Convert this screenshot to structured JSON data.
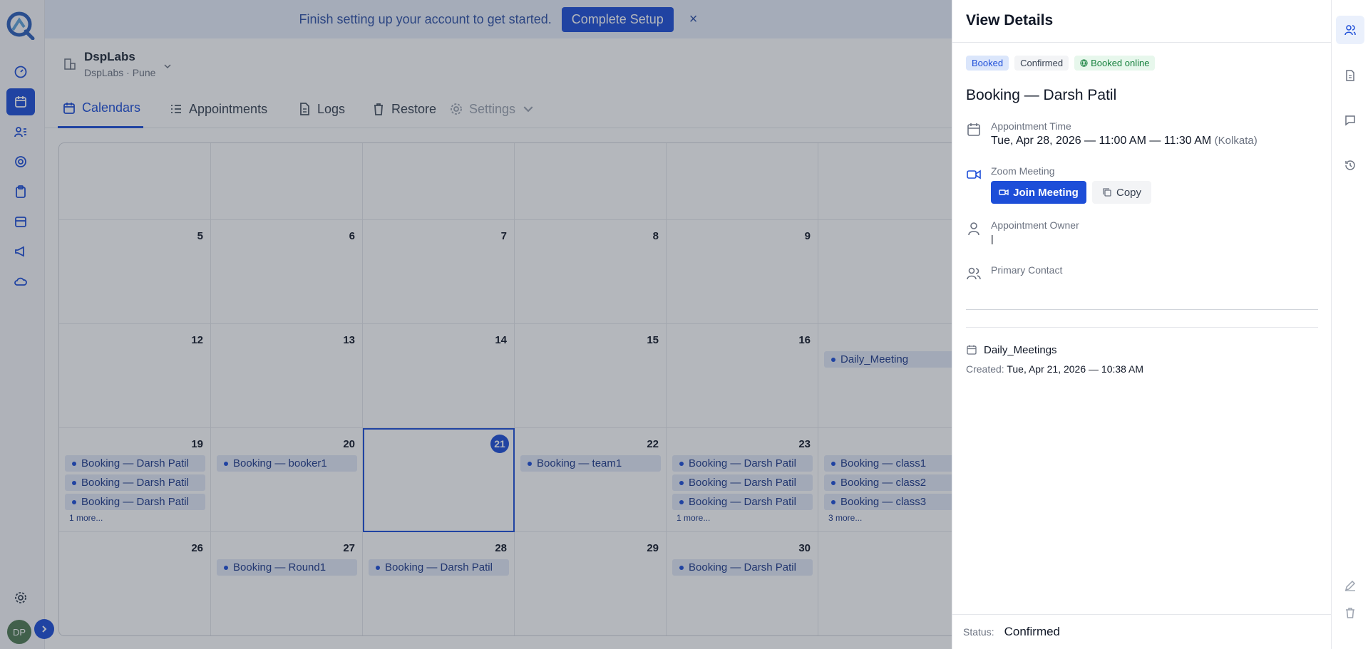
{
  "banner": {
    "text": "Finish setting up your account to get started.",
    "button": "Complete Setup",
    "close": "×"
  },
  "location": {
    "name": "DspLabs",
    "subtitle": "DspLabs · Pune"
  },
  "tabs": [
    {
      "label": "Calendars",
      "icon": "calendar-icon"
    },
    {
      "label": "Appointments",
      "icon": "list-icon"
    },
    {
      "label": "Logs",
      "icon": "document-icon"
    },
    {
      "label": "Restore",
      "icon": "trash-icon"
    },
    {
      "label": "Settings",
      "icon": "gear-icon"
    }
  ],
  "sidebar": {
    "avatar_initials": "DP"
  },
  "calendar": {
    "today": "21",
    "weeks": [
      {
        "days": [
          "",
          "",
          "",
          "",
          "",
          ""
        ]
      },
      {
        "days": [
          "5",
          "6",
          "7",
          "8",
          "9",
          ""
        ]
      },
      {
        "days": [
          "12",
          "13",
          "14",
          "15",
          "16",
          ""
        ]
      },
      {
        "days": [
          "19",
          "20",
          "21",
          "22",
          "23",
          ""
        ]
      },
      {
        "days": [
          "26",
          "27",
          "28",
          "29",
          "30",
          ""
        ]
      }
    ],
    "events": {
      "w2d5": [
        "Daily_Meeting"
      ],
      "w3d0": [
        "Booking — Darsh Patil",
        "Booking — Darsh Patil",
        "Booking — Darsh Patil"
      ],
      "w3d1": [
        "Booking — booker1"
      ],
      "w3d3": [
        "Booking — team1"
      ],
      "w3d4": [
        "Booking — Darsh Patil",
        "Booking — Darsh Patil",
        "Booking — Darsh Patil"
      ],
      "w3d5": [
        "Booking — class1",
        "Booking — class2",
        "Booking — class3"
      ],
      "w4d1": [
        "Booking — Round1"
      ],
      "w4d2": [
        "Booking — Darsh Patil"
      ],
      "w4d4": [
        "Booking — Darsh Patil"
      ]
    },
    "more": {
      "w3d0": "1 more...",
      "w3d4": "1 more...",
      "w3d5": "3 more..."
    }
  },
  "drawer": {
    "title": "View Details",
    "badges": {
      "booked": "Booked",
      "confirmed": "Confirmed",
      "online": "Booked online"
    },
    "booking_title": "Booking — Darsh Patil",
    "appointment_time_label": "Appointment Time",
    "appointment_time": "Tue, Apr 28, 2026 — 11:00 AM — 11:30 AM",
    "timezone": "(Kolkata)",
    "meeting_label": "Zoom Meeting",
    "join_label": "Join Meeting",
    "copy_label": "Copy",
    "owner_label": "Appointment Owner",
    "owner_value": "|",
    "contact_label": "Primary Contact",
    "calendar_name": "Daily_Meetings",
    "created_label": "Created:",
    "created_value": "Tue, Apr 21, 2026 — 10:38 AM",
    "status_label": "Status:",
    "status_value": "Confirmed"
  },
  "colors": {
    "accent": "#1d4ed8",
    "success": "#15803d",
    "overlay": "rgba(40,48,62,0.35)"
  }
}
